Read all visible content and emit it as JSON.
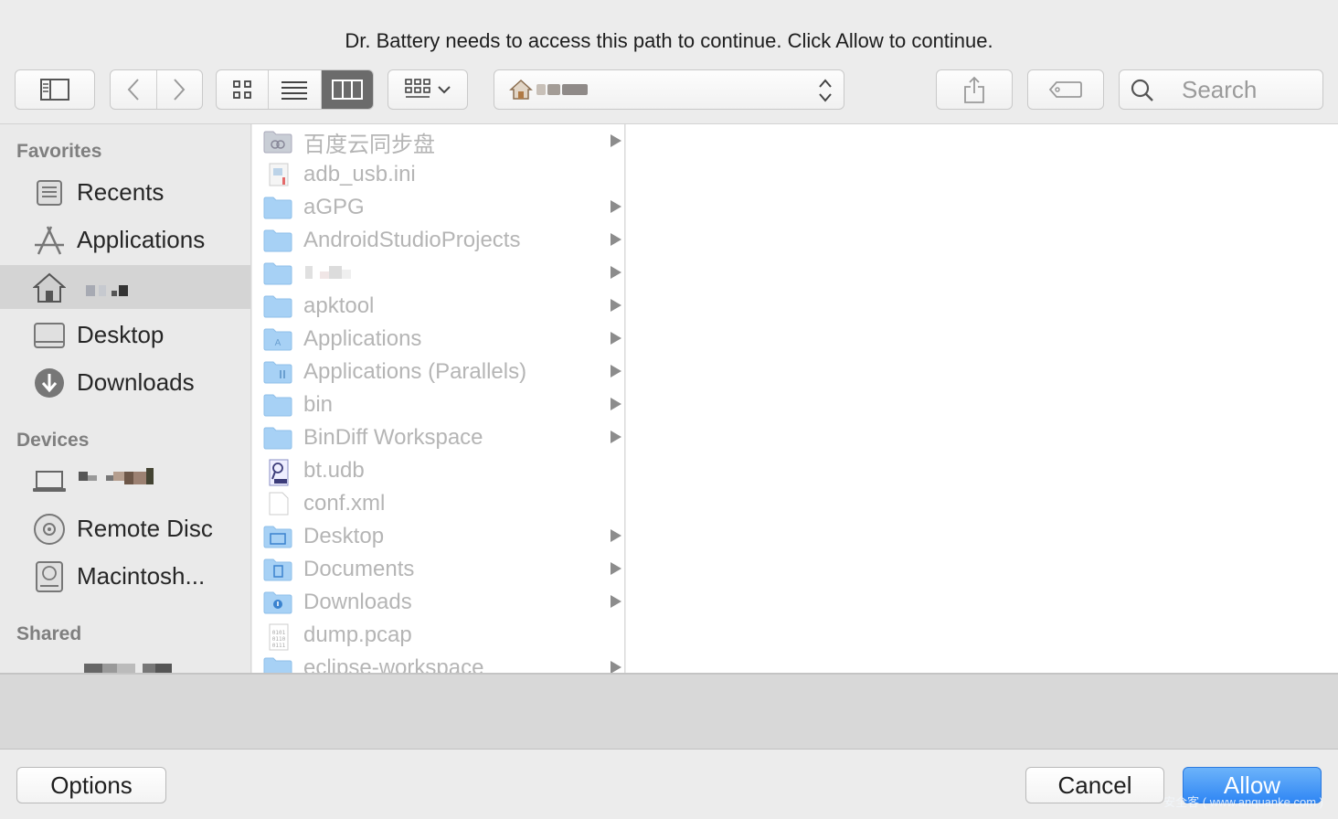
{
  "dialog": {
    "message": "Dr. Battery needs to access this path to continue. Click Allow to continue."
  },
  "toolbar": {
    "search_placeholder": "Search",
    "view_modes": [
      "icon-view",
      "list-view",
      "column-view"
    ],
    "active_view": "column-view"
  },
  "sidebar": {
    "sections": {
      "favorites": "Favorites",
      "devices": "Devices",
      "shared": "Shared"
    },
    "favorites": [
      {
        "label": "Recents",
        "icon": "recents-icon"
      },
      {
        "label": "Applications",
        "icon": "applications-icon"
      },
      {
        "label": "",
        "icon": "home-icon",
        "selected": true
      },
      {
        "label": "Desktop",
        "icon": "desktop-icon"
      },
      {
        "label": "Downloads",
        "icon": "downloads-icon"
      }
    ],
    "devices": [
      {
        "label": "",
        "icon": "laptop-icon"
      },
      {
        "label": "Remote Disc",
        "icon": "disc-icon"
      },
      {
        "label": "Macintosh...",
        "icon": "hard-drive-icon"
      }
    ]
  },
  "files": [
    {
      "name": "百度云同步盘",
      "icon": "cloud-folder-icon",
      "folder": true
    },
    {
      "name": "adb_usb.ini",
      "icon": "ini-file-icon",
      "folder": false
    },
    {
      "name": "aGPG",
      "icon": "folder-icon",
      "folder": true
    },
    {
      "name": "AndroidStudioProjects",
      "icon": "folder-icon",
      "folder": true
    },
    {
      "name": "",
      "icon": "folder-icon",
      "folder": true
    },
    {
      "name": "apktool",
      "icon": "folder-icon",
      "folder": true
    },
    {
      "name": "Applications",
      "icon": "apps-folder-icon",
      "folder": true
    },
    {
      "name": "Applications (Parallels)",
      "icon": "parallels-folder-icon",
      "folder": true
    },
    {
      "name": "bin",
      "icon": "folder-icon",
      "folder": true
    },
    {
      "name": "BinDiff Workspace",
      "icon": "folder-icon",
      "folder": true
    },
    {
      "name": "bt.udb",
      "icon": "udb-file-icon",
      "folder": false
    },
    {
      "name": "conf.xml",
      "icon": "document-icon",
      "folder": false
    },
    {
      "name": "Desktop",
      "icon": "desktop-folder-icon",
      "folder": true
    },
    {
      "name": "Documents",
      "icon": "documents-folder-icon",
      "folder": true
    },
    {
      "name": "Downloads",
      "icon": "downloads-folder-icon",
      "folder": true
    },
    {
      "name": "dump.pcap",
      "icon": "binary-file-icon",
      "folder": false
    },
    {
      "name": "eclipse-workspace",
      "icon": "folder-icon",
      "folder": true
    }
  ],
  "buttons": {
    "options": "Options",
    "cancel": "Cancel",
    "allow": "Allow"
  },
  "watermark": "安全客 ( www.anquanke.com )",
  "colors": {
    "accent": "#2f86f4",
    "folder": "#a7d1f5",
    "window_bg": "#ececec"
  }
}
